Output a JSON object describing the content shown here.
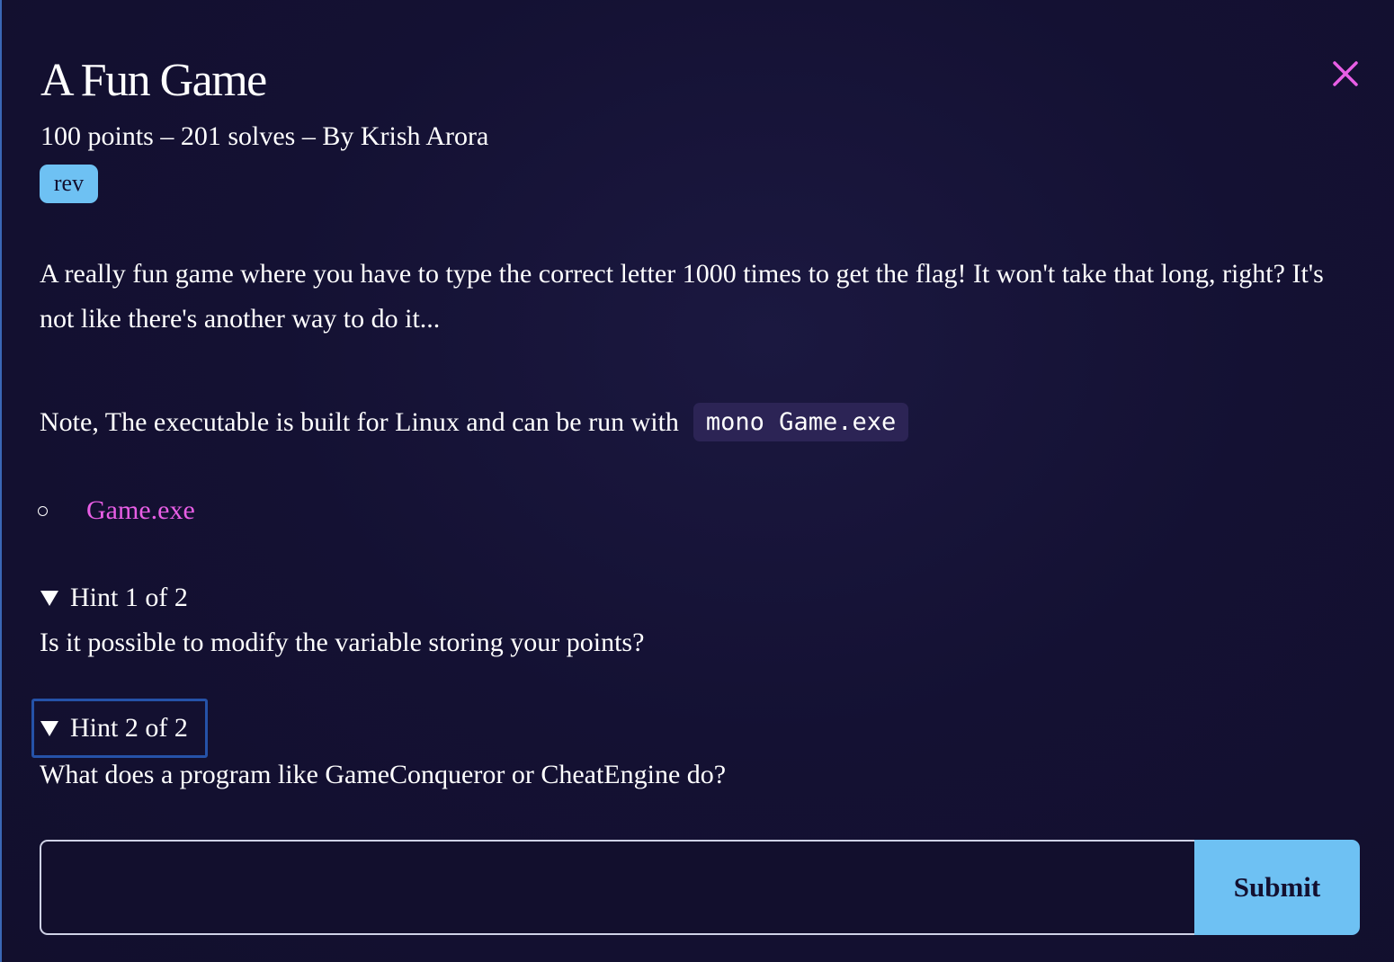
{
  "challenge": {
    "title": "A Fun Game",
    "meta": "100 points – 201 solves – By Krish Arora",
    "tag": "rev",
    "description": "A really fun game where you have to type the correct letter 1000 times to get the flag! It won't take that long, right? It's not like there's another way to do it...",
    "note": "Note, The executable is built for Linux and can be run with",
    "note_code": "mono Game.exe",
    "files": [
      {
        "name": "Game.exe"
      }
    ],
    "hints": [
      {
        "summary": "Hint 1 of 2",
        "text": "Is it possible to modify the variable storing your points?"
      },
      {
        "summary": "Hint 2 of 2",
        "text": "What does a program like GameConqueror or CheatEngine do?"
      }
    ]
  },
  "form": {
    "flag_value": "",
    "submit_label": "Submit"
  },
  "icons": {
    "close": "close-icon",
    "file_bullet": "circle-bullet-icon",
    "hint_toggle": "triangle-down-icon"
  },
  "colors": {
    "background": "#131030",
    "accent_blue": "#6ec1f3",
    "link_pink": "#e85ee5",
    "code_bg": "#2c2455",
    "focus_ring": "#2552a8"
  }
}
